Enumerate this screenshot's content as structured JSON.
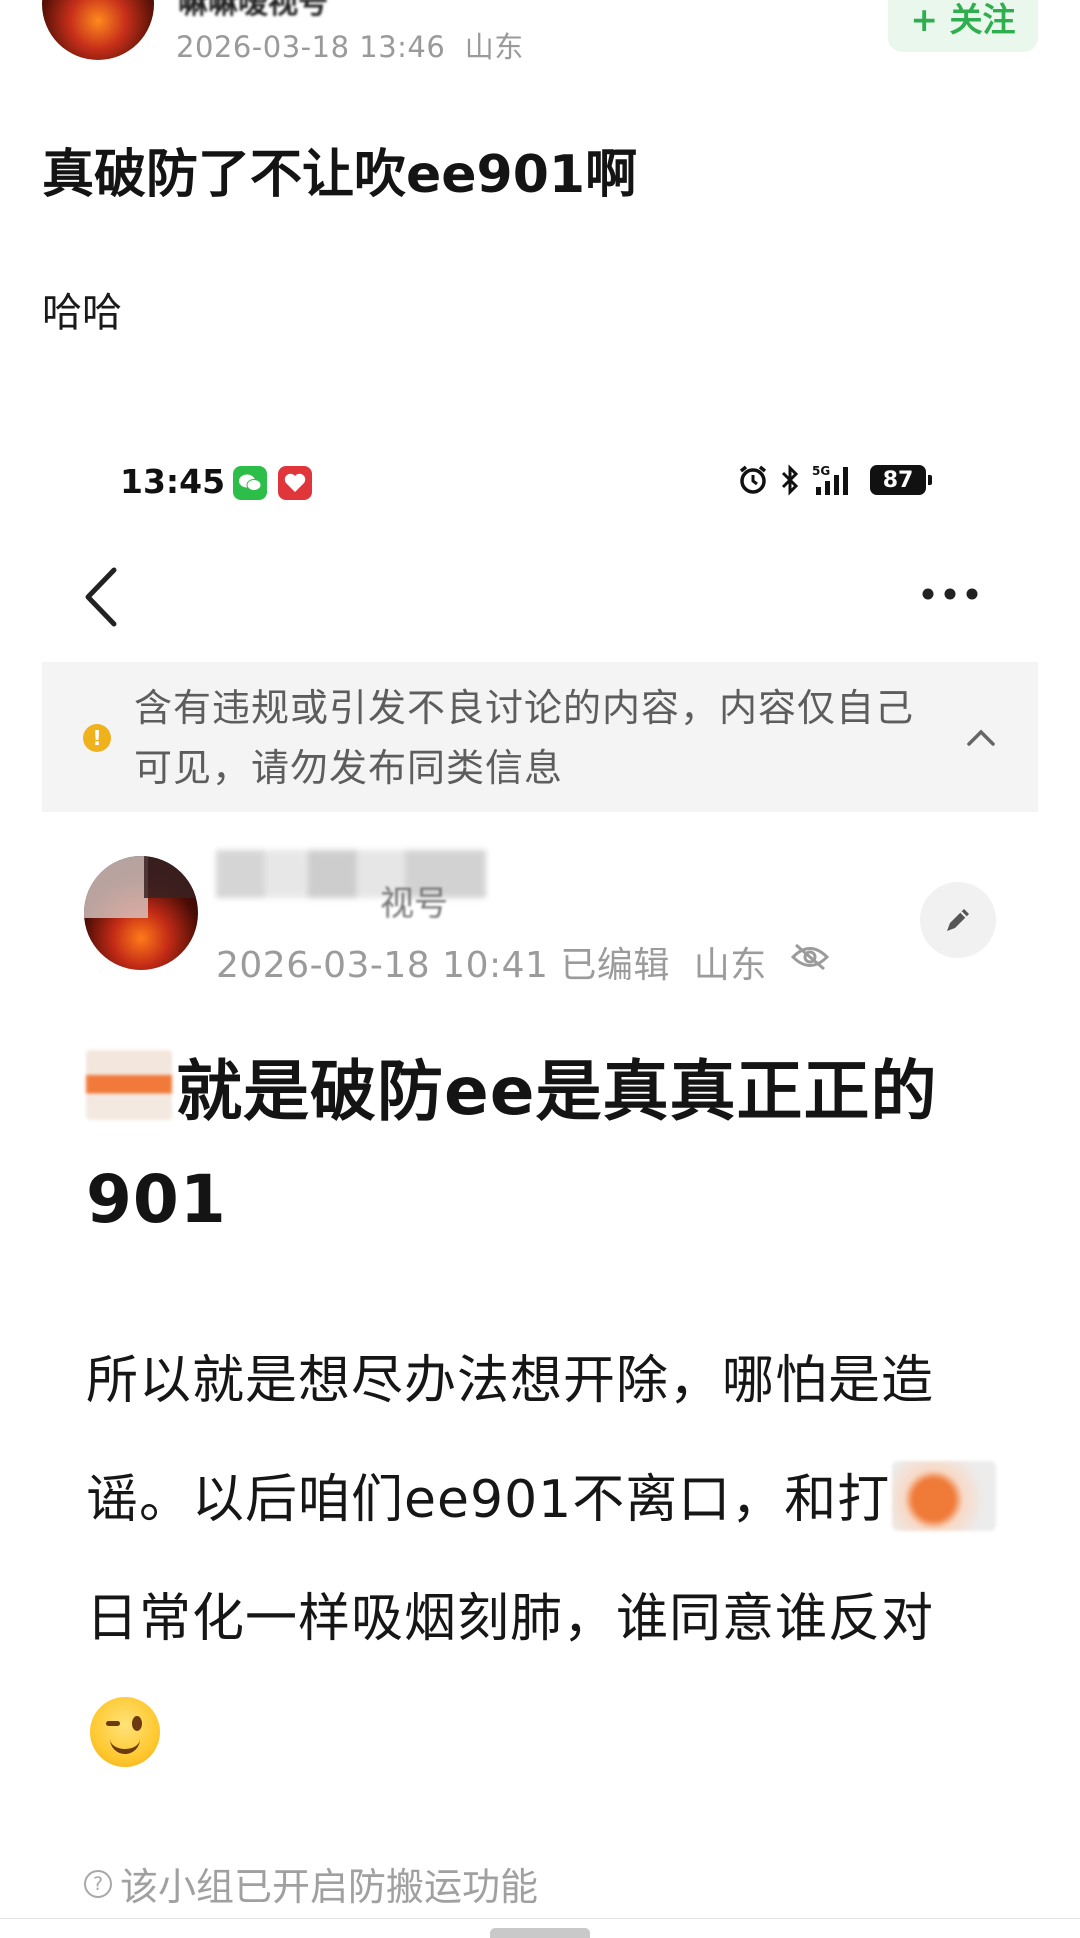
{
  "outer_post": {
    "username": "嘛嘛嗳视号",
    "timestamp": "2026-03-18 13:46",
    "location": "山东",
    "follow_label": "+ 关注",
    "title": "真破防了不让吹ee901啊",
    "body": "哈哈"
  },
  "embedded_screenshot": {
    "status_bar": {
      "time": "13:45",
      "network": "5G",
      "battery": "87"
    },
    "notice": {
      "text": "含有违规或引发不良讨论的内容，内容仅自己可见，请勿发布同类信息",
      "icon": "exclamation-icon"
    },
    "post": {
      "username_tail": "视号",
      "timestamp": "2026-03-18 10:41",
      "edited_label": "已编辑",
      "location": "山东",
      "title_text": "就是破防ee是真真正正的901",
      "body_part1": "所以就是想尽办法想开除，哪怕是造谣。以后咱们ee901不离口，和打",
      "body_part2": "日常化一样吸烟刻肺，谁同意谁反对"
    },
    "footer_note": "该小组已开启防搬运功能"
  },
  "colors": {
    "follow_green": "#2fae4f",
    "follow_bg": "#e9f7ec",
    "notice_bg": "#f4f4f4",
    "notice_icon": "#f0b21c",
    "meta_gray": "#9b9b9b"
  }
}
